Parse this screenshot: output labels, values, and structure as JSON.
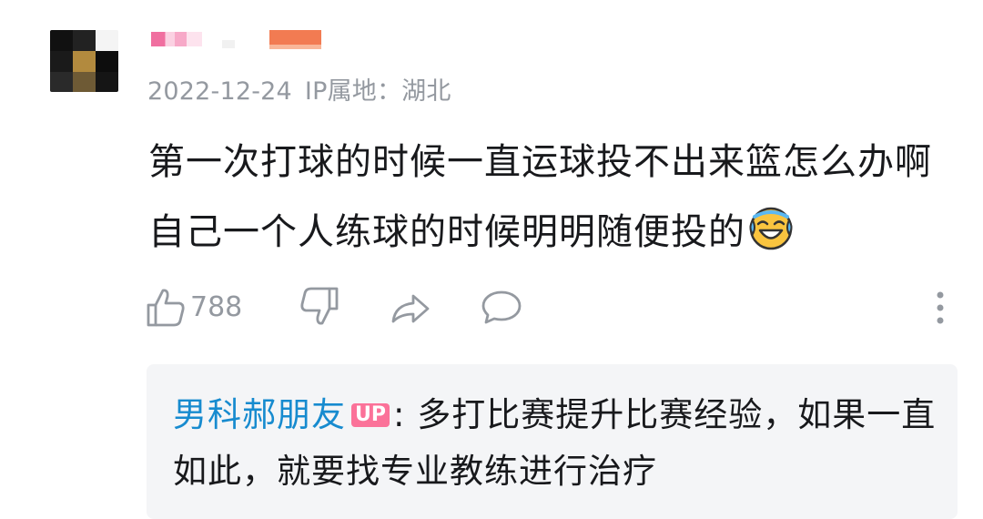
{
  "comment": {
    "date": "2022-12-24",
    "ip_location": "IP属地：湖北",
    "content_line1": "第一次打球的时候一直运球投不出来篮怎么办啊",
    "content_line2": "自己一个人练球的时候明明随便投的",
    "emoji": "laughing-tears-emoji",
    "like_count": "788"
  },
  "reply": {
    "user": "男科郝朋友",
    "badge": "UP",
    "text": ": 多打比赛提升比赛经验，如果一直如此，就要找专业教练进行治疗"
  },
  "icons": {
    "like": "thumbs-up-icon",
    "dislike": "thumbs-down-icon",
    "share": "share-icon",
    "reply": "comment-icon",
    "more": "more-vertical-icon"
  },
  "colors": {
    "meta_gray": "#9499a0",
    "reply_user_blue": "#178bcf",
    "up_badge_pink": "#fb7299",
    "reply_bg": "#f4f5f7"
  }
}
